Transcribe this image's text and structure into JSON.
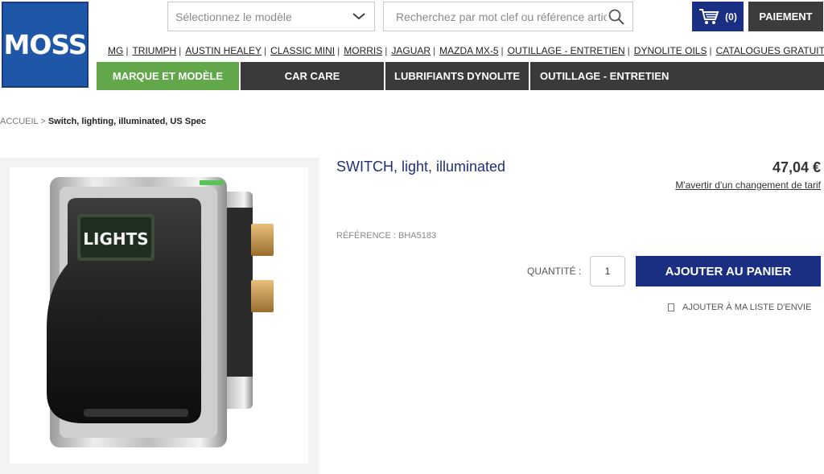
{
  "header": {
    "logo_text": "MOSS",
    "model_select": {
      "placeholder": "Sélectionnez le modèle"
    },
    "search": {
      "placeholder": "Recherchez par mot clef ou référence article"
    },
    "cart": {
      "count": "(0)"
    },
    "payment_label": "PAIEMENT"
  },
  "brand_links": [
    "MG",
    "TRIUMPH",
    "AUSTIN HEALEY",
    "CLASSIC MINI",
    "MORRIS",
    "JAGUAR",
    "MAZDA MX-5",
    "OUTILLAGE - ENTRETIEN",
    "DYNOLITE OILS",
    "CATALOGUES GRATUITS"
  ],
  "main_nav": [
    "MARQUE ET MODÈLE",
    "CAR CARE",
    "LUBRIFIANTS DYNOLITE",
    "OUTILLAGE - ENTRETIEN"
  ],
  "breadcrumb": {
    "home": "ACCUEIL",
    "separator": ">",
    "current": "Switch, lighting, illuminated, US Spec"
  },
  "product": {
    "image_text": "LIGHTS",
    "title": "SWITCH, light, illuminated",
    "price": "47,04 €",
    "price_alert": "M'avertir d'un changement de tarif",
    "reference": "RÉFÉRENCE : BHA5183",
    "quantity_label": "QUANTITÉ :",
    "quantity_value": "1",
    "add_to_cart": "AJOUTER AU PANIER",
    "wishlist": "AJOUTER À MA LISTE D'ENVIE"
  },
  "colors": {
    "brand_blue": "#1f57a8",
    "navy": "#1a2f82",
    "active_green": "#62a84a",
    "nav_dark": "#3a3a3a",
    "title_blue": "#1f2f7a"
  }
}
